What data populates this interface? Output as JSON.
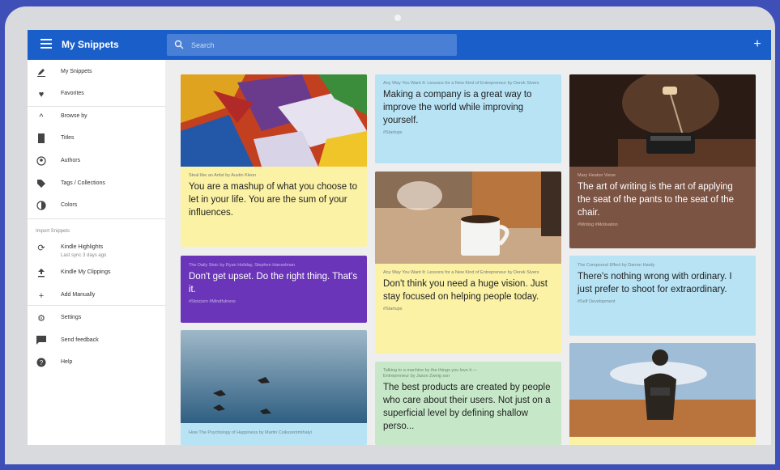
{
  "app": {
    "title": "My Snippets",
    "search_placeholder": "Search",
    "add_label": "+"
  },
  "sidebar": {
    "items": [
      {
        "label": "My Snippets"
      },
      {
        "label": "Favorites"
      },
      {
        "label": "Browse by"
      },
      {
        "label": "Titles"
      },
      {
        "label": "Authors"
      },
      {
        "label": "Tags / Collections"
      },
      {
        "label": "Colors"
      }
    ],
    "import_section": "Import Snippets",
    "import_items": [
      {
        "label": "Kindle Highlights",
        "sub": "Last sync 3 days ago"
      },
      {
        "label": "Kindle My Clippings"
      },
      {
        "label": "Add Manually"
      }
    ],
    "bottom_items": [
      {
        "label": "Settings"
      },
      {
        "label": "Send feedback"
      },
      {
        "label": "Help"
      }
    ]
  },
  "cards": [
    {
      "meta": "Steal like an Artist by Austin Kleon",
      "quote": "You are a mashup of what you choose to let in your life. You are the sum of your influences."
    },
    {
      "meta": "The Daily Stoic by Ryan Holiday, Stephen Hanselman",
      "quote": "Don't get upset. Do the right thing. That's it.",
      "foot": "#Stoicism #Mindfulness"
    },
    {
      "meta": "How The Psychology of Happiness by Martin Csikszentmihalyi"
    },
    {
      "meta": "Any Way You Want It: Lessons for a New Kind of Entrepreneur by Derek Sivers",
      "quote": "Making a company is a great way to improve the world while improving yourself.",
      "foot": "#Startups"
    },
    {
      "meta": "Any Way You Want It: Lessons for a New Kind of Entrepreneur by Derek Sivers",
      "quote": "Don't think you need a huge vision. Just stay focused on helping people today.",
      "foot": "#Startups"
    },
    {
      "meta": "Talking to a machine by the things you love it —",
      "meta2": "Entrepreneur by Jason Zweig son",
      "quote": "The best products are created by people who care about their users. Not just on a superficial level by defining shallow perso..."
    },
    {
      "meta": "Mary Heaton Vorse",
      "quote": "The art of writing is the art of applying the seat of the pants to the seat of the chair.",
      "foot": "#Writing #Motivation"
    },
    {
      "meta": "The Compound Effect by Darren Hardy",
      "quote": "There's nothing wrong with ordinary. I just prefer to shoot for extraordinary.",
      "foot": "#Self Development"
    }
  ],
  "colors": {
    "appbar": "#1a5fc9",
    "yellow": "#fbf2a5",
    "blue": "#b7e3f4",
    "purple": "#6a35b8",
    "brown": "#7c5444",
    "green": "#c6e8c8"
  }
}
